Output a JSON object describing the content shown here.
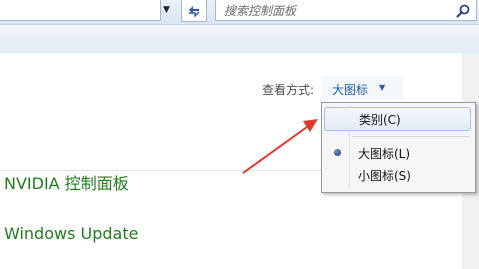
{
  "search": {
    "placeholder": "搜索控制面板"
  },
  "view": {
    "label": "查看方式:",
    "current": "大图标",
    "menu": [
      {
        "label": "类别(C)",
        "highlighted": true,
        "checked": false
      },
      {
        "label": "大图标(L)",
        "highlighted": false,
        "checked": true
      },
      {
        "label": "小图标(S)",
        "highlighted": false,
        "checked": false
      }
    ]
  },
  "items": [
    {
      "label": "NVIDIA 控制面板"
    },
    {
      "label": "Windows Update"
    }
  ],
  "colors": {
    "link": "#1e7d1e",
    "view_button_text": "#1e5fad",
    "annotation_arrow": "#e03a2f"
  }
}
